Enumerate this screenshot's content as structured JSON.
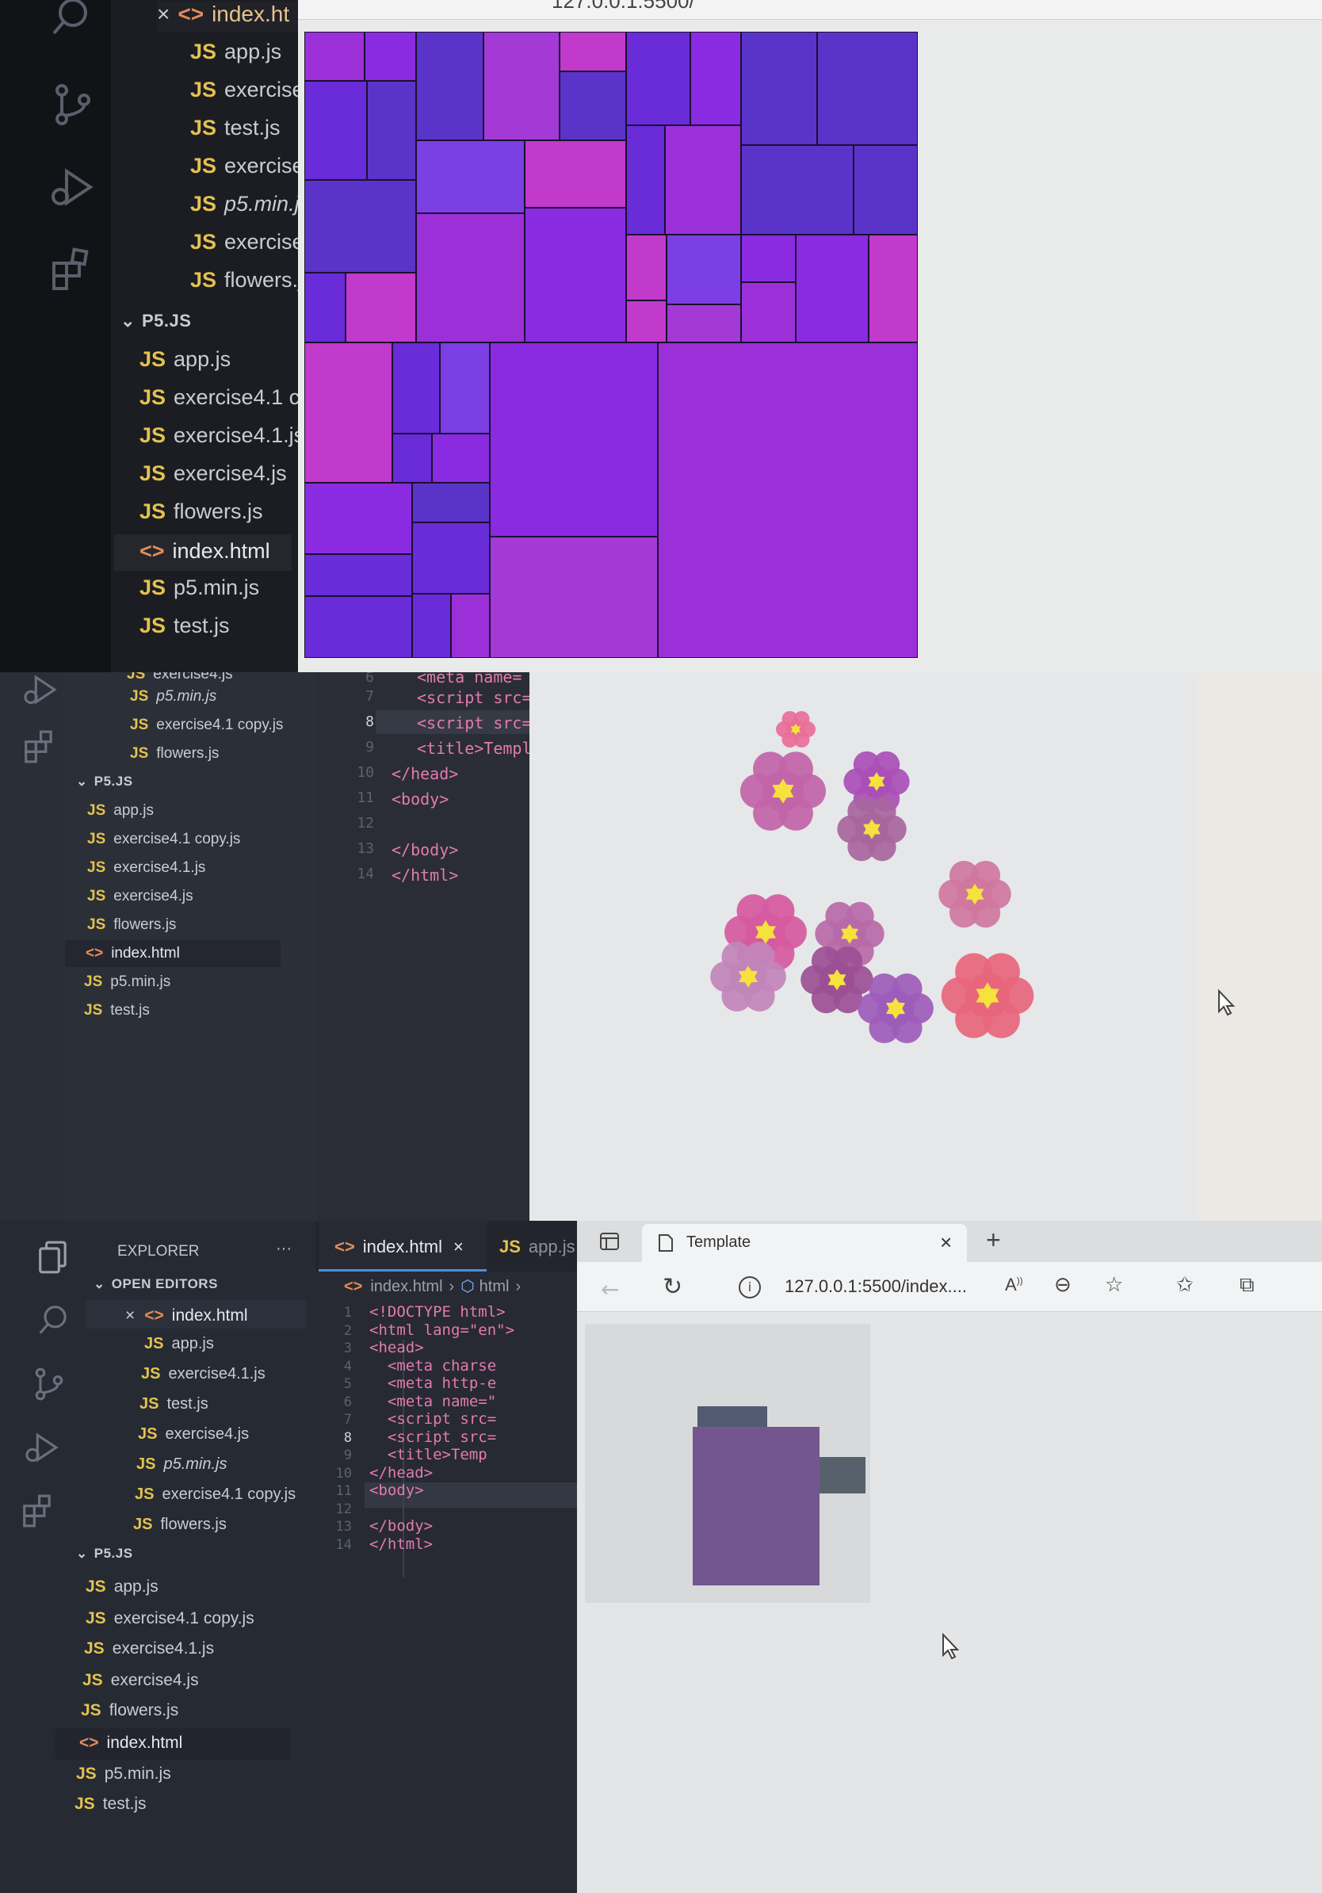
{
  "panel1": {
    "open_editors": [
      {
        "label": "index.ht",
        "type": "html",
        "close": "×"
      },
      {
        "label": "app.js",
        "type": "js"
      },
      {
        "label": "exercise",
        "type": "js"
      },
      {
        "label": "test.js",
        "type": "js"
      },
      {
        "label": "exercise",
        "type": "js"
      },
      {
        "label": "p5.min.j",
        "type": "js",
        "italic": true
      },
      {
        "label": "exercise",
        "type": "js"
      },
      {
        "label": "flowers.j",
        "type": "js"
      }
    ],
    "folder": "P5.JS",
    "files": [
      {
        "label": "app.js",
        "type": "js"
      },
      {
        "label": "exercise4.1 c",
        "type": "js"
      },
      {
        "label": "exercise4.1.js",
        "type": "js"
      },
      {
        "label": "exercise4.js",
        "type": "js"
      },
      {
        "label": "flowers.js",
        "type": "js"
      },
      {
        "label": "index.html",
        "type": "html",
        "active": true
      },
      {
        "label": "p5.min.js",
        "type": "js"
      },
      {
        "label": "test.js",
        "type": "js"
      }
    ],
    "browser_url_partial": "127.0.0.1:5500/",
    "canvas_description_colors": [
      "#6a2bd9",
      "#8a2be2",
      "#9b30d9",
      "#5a34c9",
      "#a33ad6",
      "#7b3fe4",
      "#c13acb"
    ]
  },
  "panel2": {
    "tree": [
      {
        "label": "exercise4.js",
        "type": "js"
      },
      {
        "label": "p5.min.js",
        "type": "js",
        "italic": true
      },
      {
        "label": "exercise4.1 copy.js",
        "type": "js"
      },
      {
        "label": "flowers.js",
        "type": "js"
      }
    ],
    "folder": "P5.JS",
    "files": [
      {
        "label": "app.js",
        "type": "js"
      },
      {
        "label": "exercise4.1 copy.js",
        "type": "js"
      },
      {
        "label": "exercise4.1.js",
        "type": "js"
      },
      {
        "label": "exercise4.js",
        "type": "js"
      },
      {
        "label": "flowers.js",
        "type": "js"
      },
      {
        "label": "index.html",
        "type": "html",
        "active": true
      },
      {
        "label": "p5.min.js",
        "type": "js"
      },
      {
        "label": "test.js",
        "type": "js"
      }
    ],
    "code_lines": [
      {
        "n": "6",
        "text": "<meta name="
      },
      {
        "n": "7",
        "text": "<script src="
      },
      {
        "n": "8",
        "text": "<script src="
      },
      {
        "n": "9",
        "text": "<title>Templ"
      },
      {
        "n": "10",
        "text": "</head>"
      },
      {
        "n": "11",
        "text": "<body>"
      },
      {
        "n": "12",
        "text": ""
      },
      {
        "n": "13",
        "text": "</body>"
      },
      {
        "n": "14",
        "text": "</html>"
      }
    ]
  },
  "panel3": {
    "explorer_title": "EXPLORER",
    "explorer_more": "···",
    "open_editors_title": "OPEN EDITORS",
    "open_editors": [
      {
        "label": "index.html",
        "type": "html",
        "close": "×"
      },
      {
        "label": "app.js",
        "type": "js"
      },
      {
        "label": "exercise4.1.js",
        "type": "js"
      },
      {
        "label": "test.js",
        "type": "js"
      },
      {
        "label": "exercise4.js",
        "type": "js"
      },
      {
        "label": "p5.min.js",
        "type": "js",
        "italic": true
      },
      {
        "label": "exercise4.1 copy.js",
        "type": "js"
      },
      {
        "label": "flowers.js",
        "type": "js"
      }
    ],
    "folder": "P5.JS",
    "files": [
      {
        "label": "app.js",
        "type": "js"
      },
      {
        "label": "exercise4.1 copy.js",
        "type": "js"
      },
      {
        "label": "exercise4.1.js",
        "type": "js"
      },
      {
        "label": "exercise4.js",
        "type": "js"
      },
      {
        "label": "flowers.js",
        "type": "js"
      },
      {
        "label": "index.html",
        "type": "html",
        "active": true
      },
      {
        "label": "p5.min.js",
        "type": "js"
      },
      {
        "label": "test.js",
        "type": "js"
      }
    ],
    "editor_tabs": [
      {
        "label": "index.html",
        "active": true,
        "close": "×"
      },
      {
        "label": "app.js",
        "active": false
      }
    ],
    "breadcrumb": [
      "index.html",
      "html"
    ],
    "code_lines": [
      {
        "n": "1",
        "text": "<!DOCTYPE html>"
      },
      {
        "n": "2",
        "text": "<html lang=\"en\">"
      },
      {
        "n": "3",
        "text": "<head>"
      },
      {
        "n": "4",
        "text": "  <meta charse"
      },
      {
        "n": "5",
        "text": "  <meta http-e"
      },
      {
        "n": "6",
        "text": "  <meta name=\""
      },
      {
        "n": "7",
        "text": "  <script src="
      },
      {
        "n": "8",
        "text": "  <script src="
      },
      {
        "n": "9",
        "text": "  <title>Temp"
      },
      {
        "n": "10",
        "text": "</head>"
      },
      {
        "n": "11",
        "text": "<body>"
      },
      {
        "n": "12",
        "text": ""
      },
      {
        "n": "13",
        "text": "</body>"
      },
      {
        "n": "14",
        "text": "</html>"
      }
    ],
    "browser": {
      "tab_title": "Template",
      "tab_close": "×",
      "new_tab": "+",
      "url": "127.0.0.1:5500/index...."
    }
  },
  "colors": {
    "js_badge": "#e3c24f",
    "html_badge": "#e38c5a",
    "active_file": "#25272d",
    "flower_yellow": "#f5e23c"
  },
  "icons": [
    "search-icon",
    "source-control-icon",
    "run-debug-icon",
    "extensions-icon",
    "files-icon",
    "back-icon",
    "reload-icon",
    "info-icon",
    "read-aloud-icon",
    "zoom-out-icon",
    "favorite-icon",
    "favorites-bar-icon",
    "collections-icon",
    "page-icon",
    "tab-actions-icon",
    "cursor-icon"
  ]
}
